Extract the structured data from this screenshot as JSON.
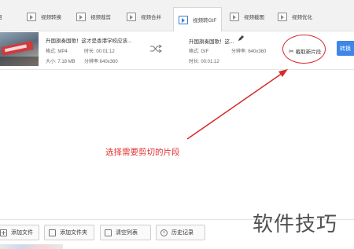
{
  "tabs": [
    {
      "label": "回",
      "icon": "video-icon"
    },
    {
      "label": "视频转换",
      "icon": "video-icon"
    },
    {
      "label": "视频裁剪",
      "icon": "video-icon"
    },
    {
      "label": "视频合并",
      "icon": "video-icon"
    },
    {
      "label": "视频转GIF",
      "icon": "video-icon",
      "active": true
    },
    {
      "label": "视频截图",
      "icon": "video-icon"
    },
    {
      "label": "视频优化",
      "icon": "video-icon"
    }
  ],
  "file": {
    "source": {
      "title": "升国旗奏国歌！这才是香港学校应该...",
      "format": "格式: MP4",
      "duration": "时长: 00:01:12",
      "size": "大小: 7.18 MB",
      "resolution": "分辨率:640x360"
    },
    "output": {
      "title": "升国旗奏国歌！这...",
      "format": "格式: GIF",
      "resolution": "分辨率: 640x360",
      "duration": "时长: 00:01:12"
    },
    "cut_label": "截取新片段",
    "convert_label": "转换"
  },
  "annotation": "选择需要剪切的片段",
  "bottom": {
    "add_file": "添加文件",
    "add_folder": "添加文件夹",
    "clear_list": "清空列表",
    "history": "历史记录"
  },
  "watermark": "软件技巧",
  "colors": {
    "accent": "#3e86e8",
    "annotation": "#e23333"
  }
}
